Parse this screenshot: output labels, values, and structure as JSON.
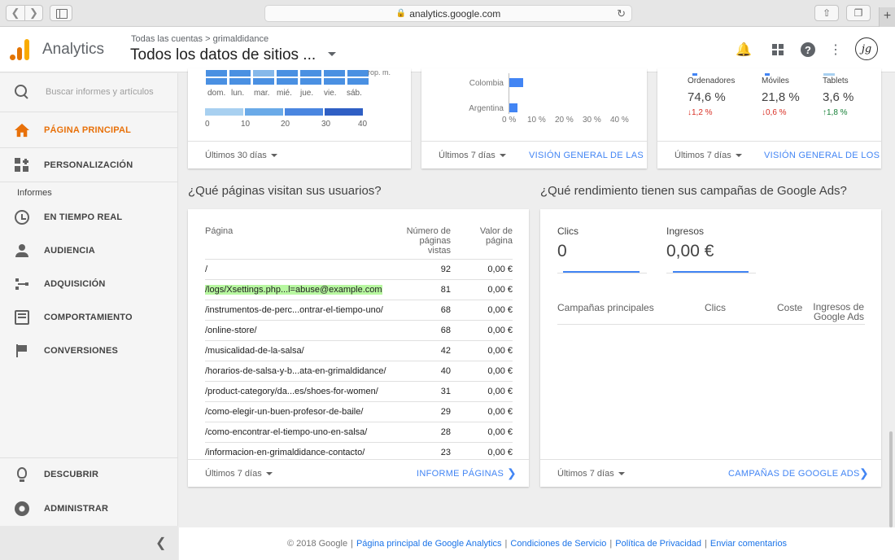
{
  "browser": {
    "url": "analytics.google.com",
    "lock_icon": "lock-icon",
    "reload_icon": "reload-icon"
  },
  "header": {
    "app_name": "Analytics",
    "breadcrumb": "Todas las cuentas > grimaldidance",
    "view_name": "Todos los datos de sitios ...",
    "avatar_text": "jg",
    "brand_colors": {
      "orange": "#e8710a",
      "yellow": "#f9ab00"
    }
  },
  "sidebar": {
    "search_placeholder": "Buscar informes y artículos",
    "home": "PÁGINA PRINCIPAL",
    "customization": "PERSONALIZACIÓN",
    "reports_label": "Informes",
    "items": [
      "EN TIEMPO REAL",
      "AUDIENCIA",
      "ADQUISICIÓN",
      "COMPORTAMIENTO",
      "CONVERSIONES"
    ],
    "discover": "DESCUBRIR",
    "admin": "ADMINISTRAR",
    "active_color": "#e8710a"
  },
  "card_hours": {
    "days": [
      "dom.",
      "lun.",
      "mar.",
      "mié.",
      "jue.",
      "vie.",
      "sáb."
    ],
    "cut_label": "rop. m.",
    "legend_ticks": [
      "0",
      "10",
      "20",
      "30",
      "40"
    ],
    "range": "Últimos 30 días"
  },
  "card_countries": {
    "chart_data": {
      "type": "bar",
      "categories": [
        "Colombia",
        "Argentina"
      ],
      "values": [
        5,
        3
      ],
      "xlim": [
        0,
        40
      ],
      "ticks": [
        "0 %",
        "10 %",
        "20 %",
        "30 %",
        "40 %"
      ]
    },
    "range": "Últimos 7 días",
    "link": "VISIÓN GENERAL DE LAS UB"
  },
  "card_devices": {
    "devices": [
      {
        "label": "Ordenadores",
        "value": "74,6 %",
        "change": "1,2 %",
        "dir": "down",
        "arrow": "↓"
      },
      {
        "label": "Móviles",
        "value": "21,8 %",
        "change": "0,6 %",
        "dir": "down",
        "arrow": "↓"
      },
      {
        "label": "Tablets",
        "value": "3,6 %",
        "change": "1,8 %",
        "dir": "up",
        "arrow": "↑"
      }
    ],
    "range": "Últimos 7 días",
    "link": "VISIÓN GENERAL DE LOS MO"
  },
  "sections": {
    "pages_q": "¿Qué páginas visitan sus usuarios?",
    "ads_q": "¿Qué rendimiento tienen sus campañas de Google Ads?"
  },
  "pages_table": {
    "col_page": "Página",
    "col_views": "Número de páginas vistas",
    "col_value": "Valor de página",
    "rows": [
      {
        "page": "/",
        "views": "92",
        "value": "0,00 €"
      },
      {
        "page": "/logs/Xsettings.php...l=abuse@example.com",
        "views": "81",
        "value": "0,00 €"
      },
      {
        "page": "/instrumentos-de-perc...ontrar-el-tiempo-uno/",
        "views": "68",
        "value": "0,00 €"
      },
      {
        "page": "/online-store/",
        "views": "68",
        "value": "0,00 €"
      },
      {
        "page": "/musicalidad-de-la-salsa/",
        "views": "42",
        "value": "0,00 €"
      },
      {
        "page": "/horarios-de-salsa-y-b...ata-en-grimaldidance/",
        "views": "40",
        "value": "0,00 €"
      },
      {
        "page": "/product-category/da...es/shoes-for-women/",
        "views": "31",
        "value": "0,00 €"
      },
      {
        "page": "/como-elegir-un-buen-profesor-de-baile/",
        "views": "29",
        "value": "0,00 €"
      },
      {
        "page": "/como-encontrar-el-tiempo-uno-en-salsa/",
        "views": "28",
        "value": "0,00 €"
      },
      {
        "page": "/informacion-en-grimaldidance-contacto/",
        "views": "23",
        "value": "0,00 €"
      }
    ],
    "range": "Últimos 7 días",
    "link": "INFORME PÁGINAS"
  },
  "ads_card": {
    "clicks_label": "Clics",
    "clicks_value": "0",
    "revenue_label": "Ingresos",
    "revenue_value": "0,00 €",
    "col_campaigns": "Campañas principales",
    "col_clicks": "Clics",
    "col_cost": "Coste",
    "col_revenue": "Ingresos de Google Ads",
    "range": "Últimos 7 días",
    "link": "CAMPAÑAS DE GOOGLE ADS"
  },
  "footer": {
    "copyright": "© 2018 Google",
    "links": [
      "Página principal de Google Analytics",
      "Condiciones de Servicio",
      "Política de Privacidad",
      "Enviar comentarios"
    ]
  }
}
